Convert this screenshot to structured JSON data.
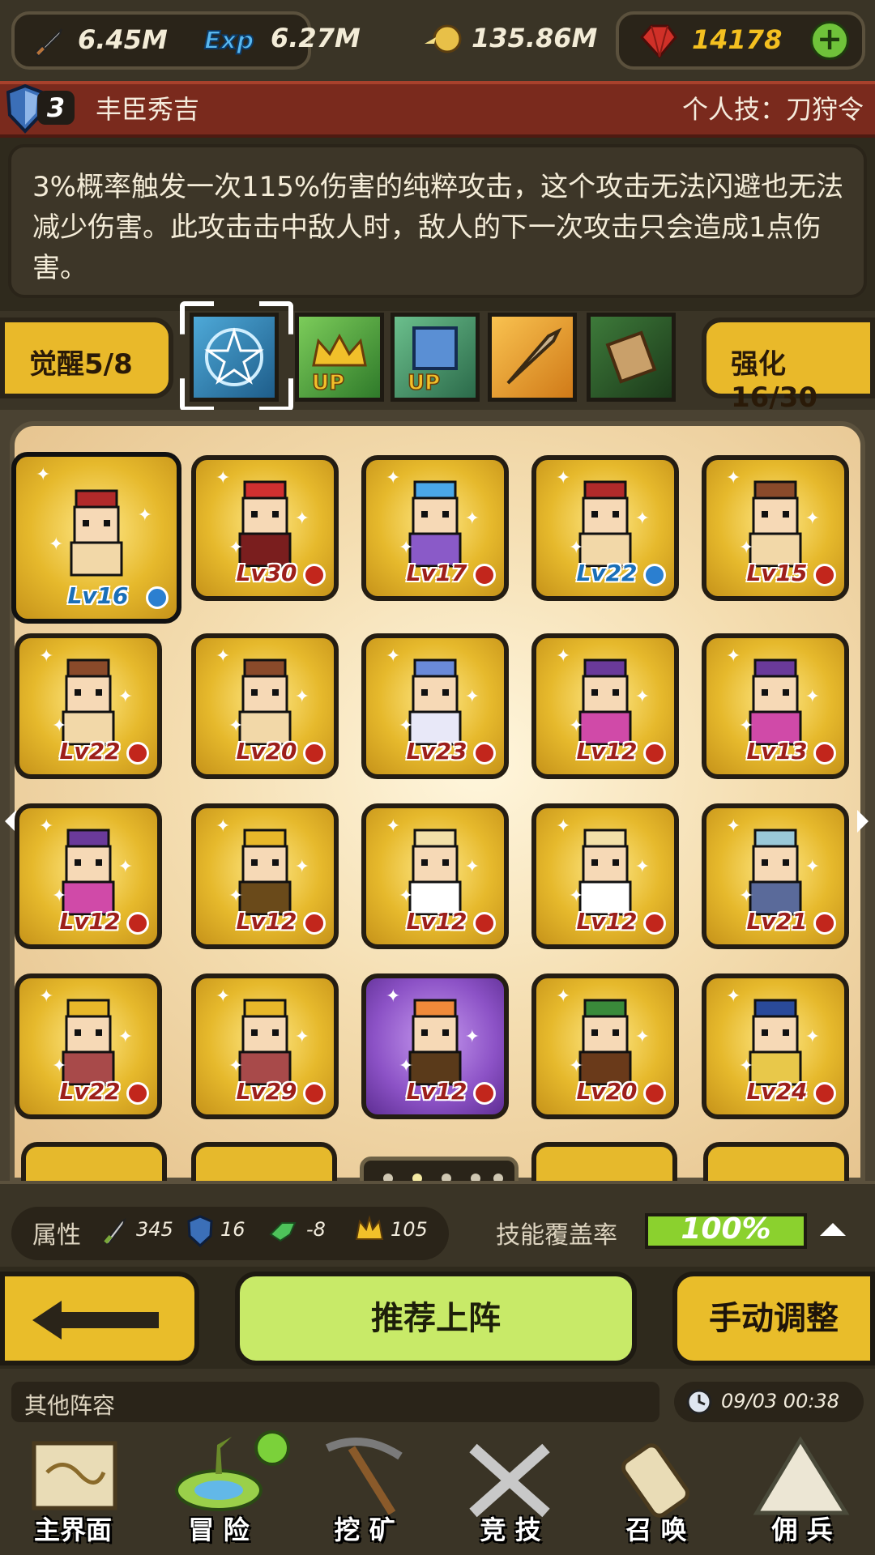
{
  "currencies": {
    "attack_value": "6.45M",
    "exp_value": "6.27M",
    "gold_value": "135.86M",
    "gem_value": "14178"
  },
  "hero": {
    "awaken_level": "3",
    "name": "丰臣秀吉",
    "skill_title": "个人技：刀狩令",
    "description": "3%概率触发一次115%伤害的纯粹攻击，这个攻击无法闪避也无法减少伤害。此攻击击中敌人时，敌人的下一次攻击只会造成1点伤害。"
  },
  "skill_row": {
    "awaken_label": "觉醒5/8",
    "strengthen_label": "强化16/30",
    "icons": [
      "star-circle-icon",
      "crown-up-icon",
      "shield-up-icon",
      "staff-icon",
      "scroll-icon"
    ]
  },
  "roster": [
    {
      "lv": "Lv16",
      "badge": "blue"
    },
    {
      "lv": "Lv30",
      "badge": "red"
    },
    {
      "lv": "Lv17",
      "badge": "red"
    },
    {
      "lv": "Lv22",
      "badge": "blue"
    },
    {
      "lv": "Lv15",
      "badge": "red"
    },
    {
      "lv": "Lv22",
      "badge": "red"
    },
    {
      "lv": "Lv20",
      "badge": "red"
    },
    {
      "lv": "Lv23",
      "badge": "red"
    },
    {
      "lv": "Lv12",
      "badge": "red"
    },
    {
      "lv": "Lv13",
      "badge": "red"
    },
    {
      "lv": "Lv12",
      "badge": "red"
    },
    {
      "lv": "Lv12",
      "badge": "red"
    },
    {
      "lv": "Lv12",
      "badge": "red"
    },
    {
      "lv": "Lv12",
      "badge": "red"
    },
    {
      "lv": "Lv21",
      "badge": "red"
    },
    {
      "lv": "Lv22",
      "badge": "red"
    },
    {
      "lv": "Lv29",
      "badge": "red"
    },
    {
      "lv": "Lv12",
      "badge": "red"
    },
    {
      "lv": "Lv20",
      "badge": "red"
    },
    {
      "lv": "Lv24",
      "badge": "red"
    }
  ],
  "attributes": {
    "label": "属性",
    "attack": "345",
    "defense": "16",
    "speed": "-8",
    "crown": "105",
    "coverage_label": "技能覆盖率",
    "coverage_value": "100%"
  },
  "actions": {
    "recommend": "推荐上阵",
    "manual": "手动调整"
  },
  "other": {
    "label": "其他阵容",
    "time": "09/03 00:38"
  },
  "nav": [
    {
      "label": "主界面"
    },
    {
      "label": "冒 险"
    },
    {
      "label": "挖 矿"
    },
    {
      "label": "竞 技"
    },
    {
      "label": "召 唤"
    },
    {
      "label": "佣 兵"
    }
  ],
  "colors": {
    "gold_card": "#e6b92c",
    "purple_card": "#8c52c6",
    "hero_bar": "#7a2a1d",
    "coverage": "#8bd12e"
  }
}
